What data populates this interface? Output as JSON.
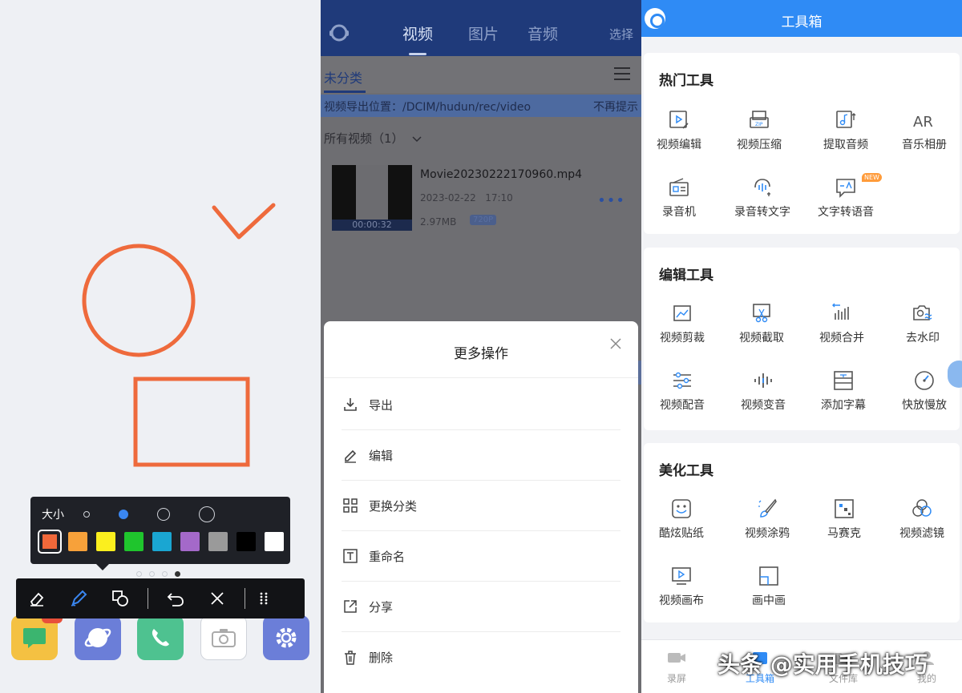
{
  "pen_popup": {
    "size_label": "大小",
    "colors": [
      "#f0683a",
      "#f7a13a",
      "#fbef1e",
      "#1fc52d",
      "#1aa6d2",
      "#a469c9",
      "#9a9a9a",
      "#000000",
      "#ffffff"
    ]
  },
  "recorder": {
    "tabs": [
      "视频",
      "图片",
      "音频"
    ],
    "select": "选择",
    "category": "未分类",
    "notice": "视频导出位置：/DCIM/hudun/rec/video",
    "notice_dismiss": "不再提示",
    "all_videos": "所有视频（1）",
    "video": {
      "name": "Movie20230222170960.mp4",
      "date": "2023-02-22",
      "time": "17:10",
      "size": "2.97MB",
      "resolution": "720P",
      "duration": "00:00:32"
    },
    "sheet": {
      "title": "更多操作",
      "items": [
        "导出",
        "编辑",
        "更换分类",
        "重命名",
        "分享",
        "删除"
      ]
    }
  },
  "toolbox": {
    "title": "工具箱",
    "sections": [
      {
        "title": "热门工具",
        "tools": [
          "视频编辑",
          "视频压缩",
          "提取音频",
          "音乐相册",
          "录音机",
          "录音转文字",
          "文字转语音"
        ]
      },
      {
        "title": "编辑工具",
        "tools": [
          "视频剪裁",
          "视频截取",
          "视频合并",
          "去水印",
          "视频配音",
          "视频变音",
          "添加字幕",
          "快放慢放"
        ]
      },
      {
        "title": "美化工具",
        "tools": [
          "酷炫贴纸",
          "视频涂鸦",
          "马赛克",
          "视频滤镜",
          "视频画布",
          "画中画"
        ]
      }
    ],
    "new_badge": "NEW",
    "bottom_nav": [
      "录屏",
      "工具箱",
      "文件库",
      "我的"
    ]
  },
  "watermark": "头条 @实用手机技巧"
}
